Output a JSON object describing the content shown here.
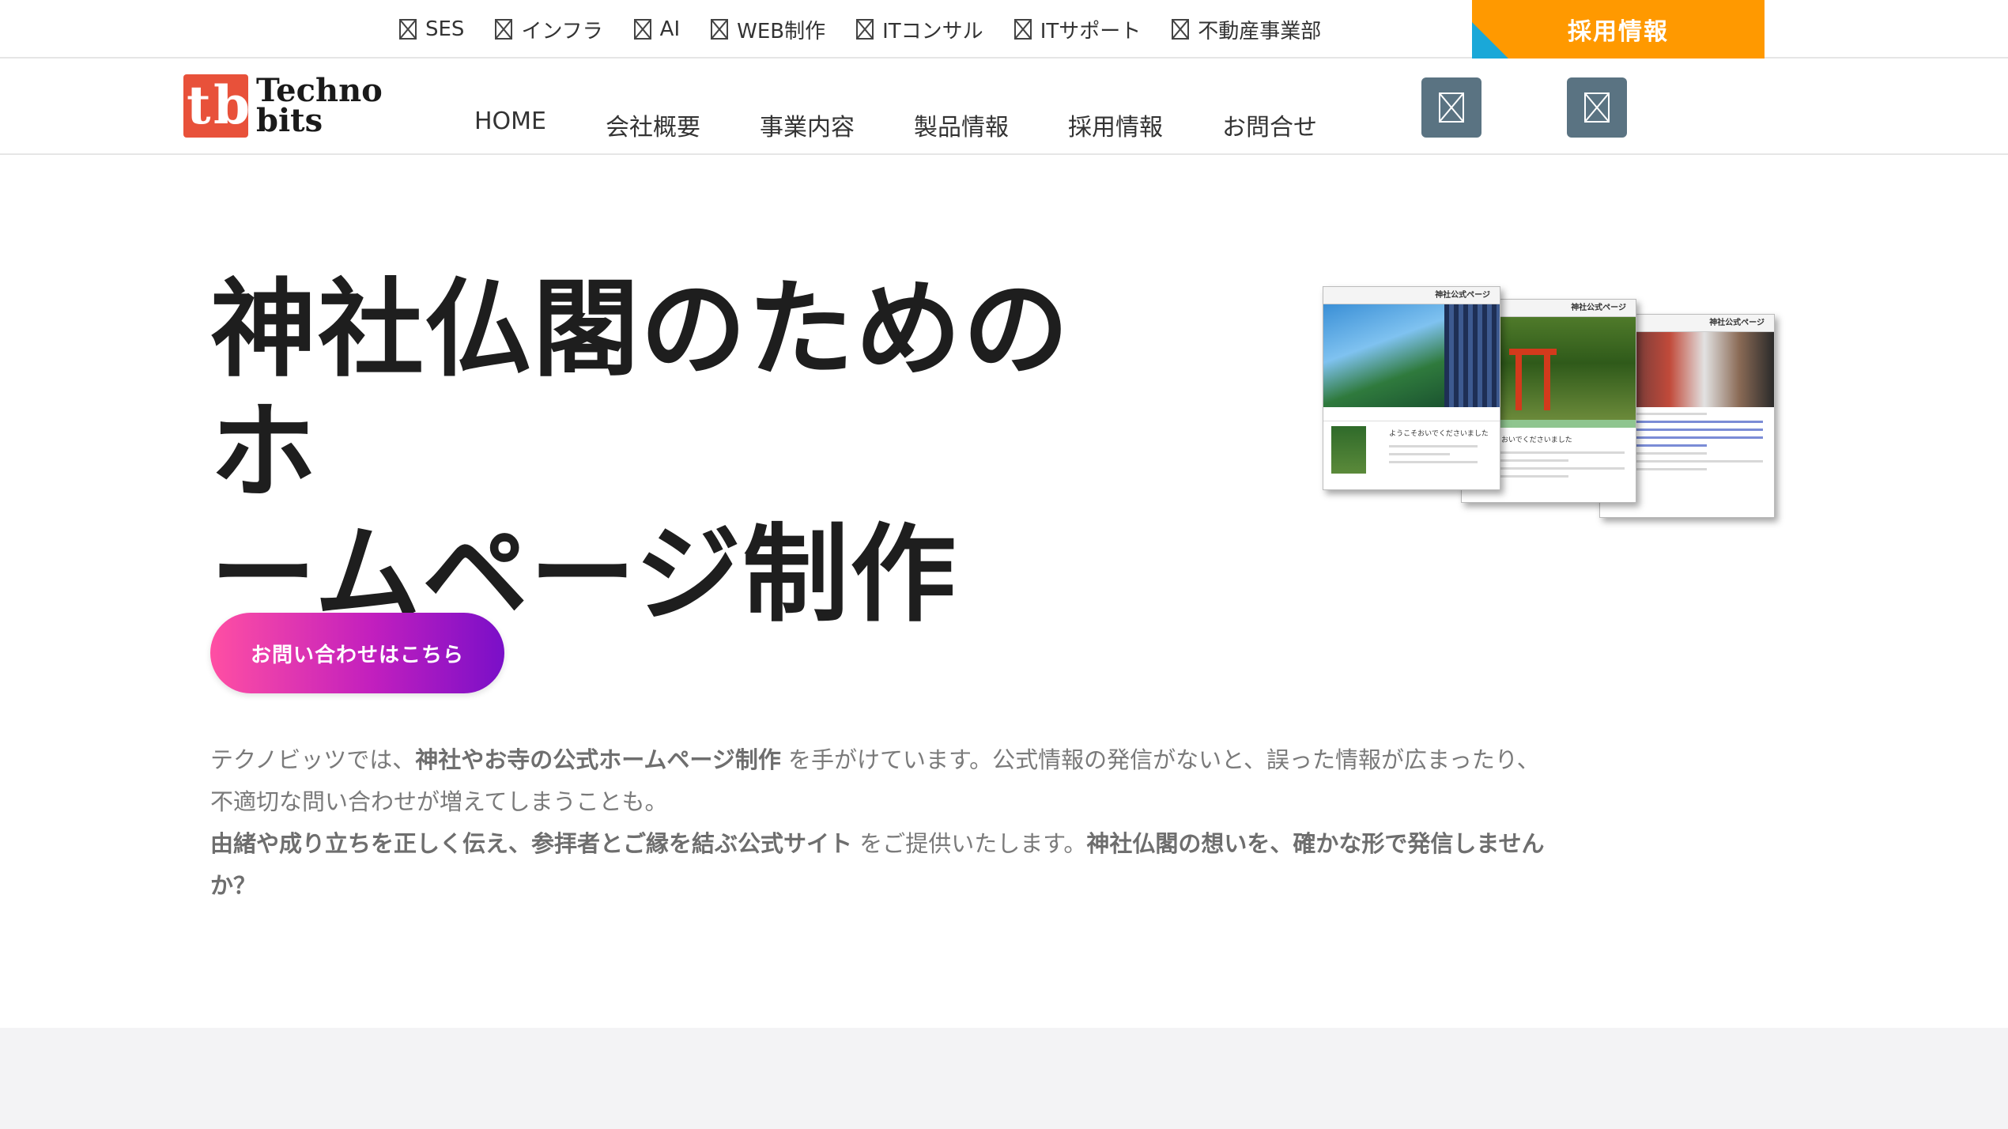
{
  "topnav": {
    "items": [
      {
        "label": "SES"
      },
      {
        "label": "インフラ"
      },
      {
        "label": "AI"
      },
      {
        "label": "WEB制作"
      },
      {
        "label": "ITコンサル"
      },
      {
        "label": "ITサポート"
      },
      {
        "label": "不動産事業部"
      }
    ],
    "recruit_label": "採用情報"
  },
  "header": {
    "logo": {
      "mark_t": "t",
      "mark_b": "b",
      "line1": "Techno",
      "line2": "bits"
    },
    "nav": [
      {
        "label": "HOME"
      },
      {
        "label": "会社概要"
      },
      {
        "label": "事業内容"
      },
      {
        "label": "製品情報"
      },
      {
        "label": "採用情報"
      },
      {
        "label": "お問合せ"
      }
    ]
  },
  "hero": {
    "title_line1": "神社仏閣のためのホ",
    "title_line2": "ームページ制作",
    "cta_label": "お問い合わせはこちら"
  },
  "description": {
    "p1_a": "テクノビッツでは、",
    "p1_b": "神社やお寺の公式ホームページ制作",
    "p1_c": " を手がけています。公式情報の発信がないと、誤った情報が広まったり、不適切な問い合わせが増えてしまうことも。",
    "p2_a": "由緒や成り立ちを正しく伝え、参拝者とご縁を結ぶ公式サイト",
    "p2_b": " をご提供いたします。",
    "p2_c": "神社仏閣の想いを、確かな形で発信しませんか？"
  },
  "mockups": {
    "header_label": "神社公式ページ",
    "welcome": "ようこそおいでくださいました"
  },
  "colors": {
    "recruit_orange": "#ff9900",
    "recruit_corner": "#1aa8d8",
    "cta_gradient_start": "#ff4fa3",
    "cta_gradient_end": "#7a0fc8",
    "icon_button_bg": "#5a7382",
    "logo_red": "#e8513a"
  }
}
